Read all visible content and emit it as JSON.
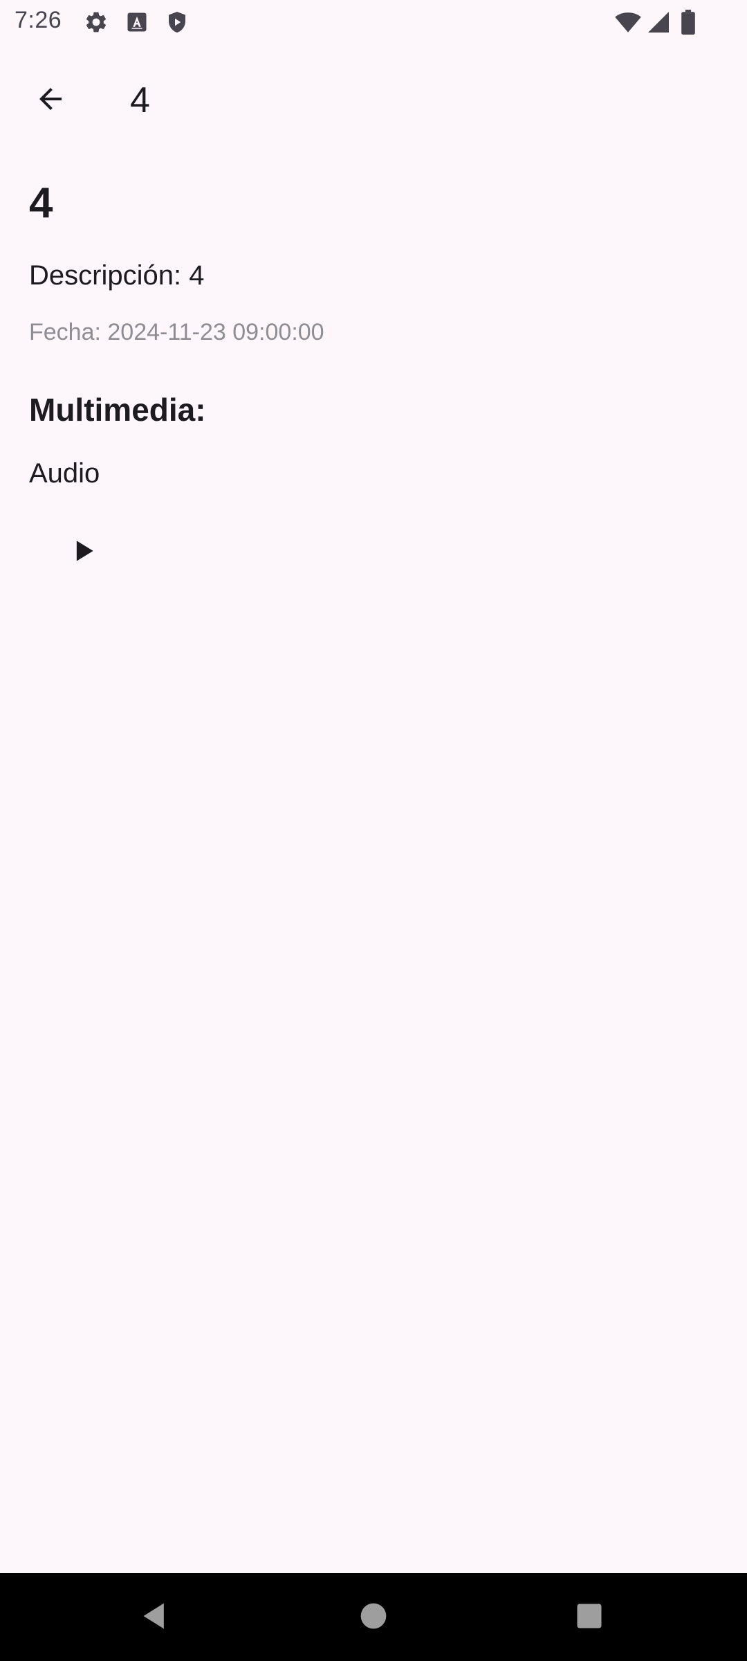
{
  "status_bar": {
    "time": "7:26",
    "icons": [
      "gear-icon",
      "text-a-icon",
      "shield-play-icon",
      "wifi-icon",
      "signal-icon",
      "battery-icon"
    ]
  },
  "app_bar": {
    "title": "4",
    "back_icon": "arrow-back-icon"
  },
  "detail": {
    "title": "4",
    "description": "Descripción: 4",
    "date": "Fecha: 2024-11-23 09:00:00",
    "multimedia_heading": "Multimedia:",
    "media_type": "Audio",
    "play_icon": "play-icon"
  },
  "nav_bar": {
    "back_icon": "nav-back-icon",
    "home_icon": "nav-home-icon",
    "recents_icon": "nav-recents-icon"
  },
  "colors": {
    "background": "#fdf7fc",
    "text_primary": "#1d1b20",
    "text_secondary": "#8f8c93",
    "nav_background": "#000000"
  }
}
